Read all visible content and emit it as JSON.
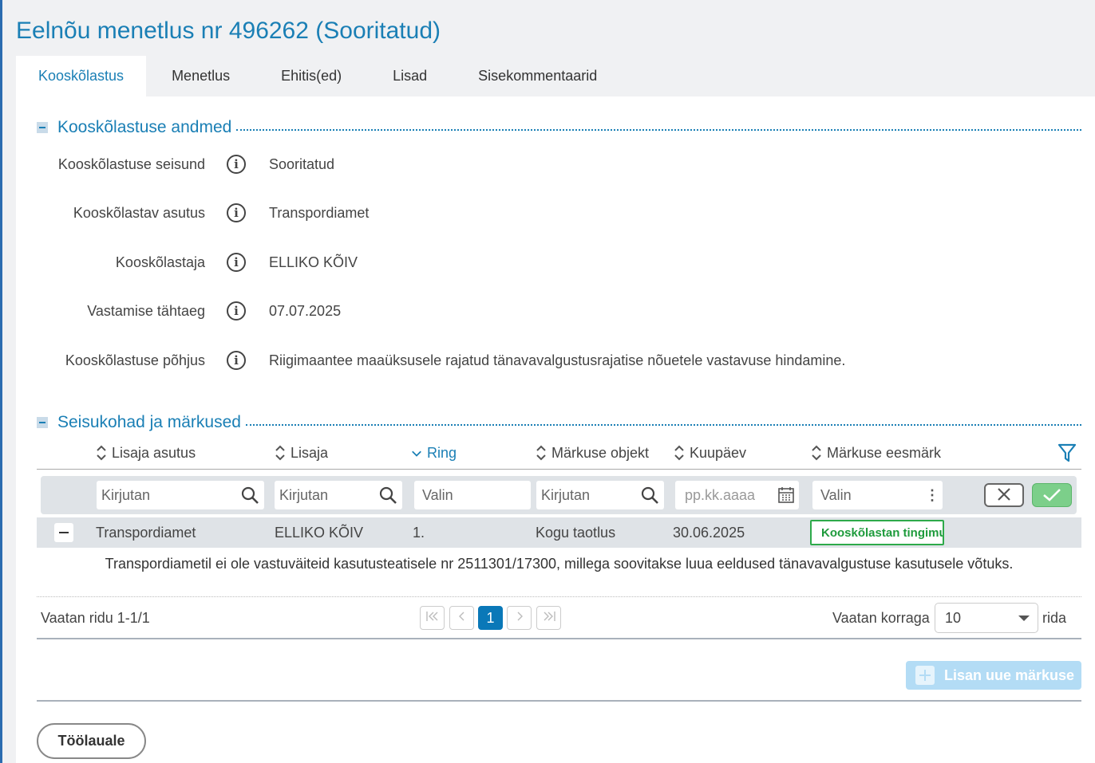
{
  "page_title": "Eelnõu menetlus nr 496262 (Sooritatud)",
  "tabs": [
    {
      "label": "Kooskõlastus",
      "active": true
    },
    {
      "label": "Menetlus"
    },
    {
      "label": "Ehitis(ed)"
    },
    {
      "label": "Lisad"
    },
    {
      "label": "Sisekommentaarid"
    }
  ],
  "section1": {
    "title": "Kooskõlastuse andmed",
    "fields": [
      {
        "label": "Kooskõlastuse seisund",
        "value": "Sooritatud"
      },
      {
        "label": "Kooskõlastav asutus",
        "value": "Transpordiamet"
      },
      {
        "label": "Kooskõlastaja",
        "value": "ELLIKO KÕIV"
      },
      {
        "label": "Vastamise tähtaeg",
        "value": "07.07.2025"
      },
      {
        "label": "Kooskõlastuse põhjus",
        "value": "Riigimaantee maaüksusele rajatud tänavavalgustusrajatise nõuetele vastavuse hindamine."
      }
    ]
  },
  "section2": {
    "title": "Seisukohad ja märkused",
    "columns": [
      "Lisaja asutus",
      "Lisaja",
      "Ring",
      "Märkuse objekt",
      "Kuupäev",
      "Märkuse eesmärk"
    ],
    "sorted_column": "Ring",
    "filters": {
      "lisaja_asutus": "Kirjutan",
      "lisaja": "Kirjutan",
      "ring": "Valin",
      "markuse_objekt": "Kirjutan",
      "kuupaev": "pp.kk.aaaa",
      "eesmark": "Valin"
    },
    "rows": [
      {
        "lisaja_asutus": "Transpordiamet",
        "lisaja": "ELLIKO KÕIV",
        "ring": "1.",
        "markuse_objekt": "Kogu taotlus",
        "kuupaev": "30.06.2025",
        "eesmark": "Kooskõlastan tingimu",
        "detail": "Transpordiametil ei ole vastuväiteid kasutusteatisele nr 2511301/17300, millega soovitakse luua eeldused tänavavalgustuse kasutusele võtuks."
      }
    ],
    "pager": {
      "info": "Vaatan ridu 1-1/1",
      "current_page": "1",
      "per_page_label": "Vaatan korraga",
      "per_page_value": "10",
      "per_page_suffix": "rida"
    },
    "add_button": "Lisan uue märkuse"
  },
  "back_button": "Töölauale",
  "colors": {
    "accent": "#1a7fb5",
    "badge_green": "#1e9b3c",
    "page_blue": "#0a78b8"
  }
}
